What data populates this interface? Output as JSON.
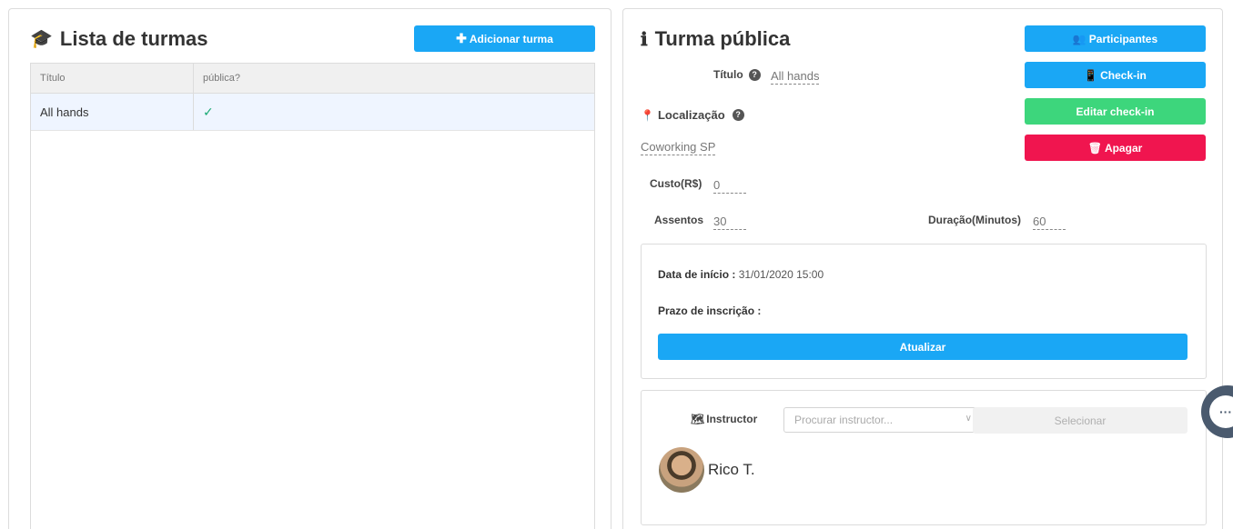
{
  "left": {
    "title": "Lista de turmas",
    "title_icon": "graduation-cap-icon",
    "add_button_label": "Adicionar turma",
    "table": {
      "columns": [
        "Título",
        "pública?"
      ],
      "rows": [
        {
          "title": "All hands",
          "public": "✓"
        }
      ]
    }
  },
  "right": {
    "title": "Turma pública",
    "title_icon": "info-icon",
    "buttons": {
      "participants": "Participantes",
      "checkin": "Check-in",
      "edit_checkin": "Editar check-in",
      "delete": "Apagar"
    },
    "fields": {
      "title_label": "Título",
      "title_value": "All hands",
      "location_label": "Localização",
      "location_value": "Coworking SP",
      "cost_label": "Custo(R$)",
      "cost_value": "0",
      "seats_label": "Assentos",
      "seats_value": "30",
      "duration_label": "Duração(Minutos)",
      "duration_value": "60"
    },
    "dates": {
      "start_label": "Data de início :",
      "start_value": "31/01/2020 15:00",
      "deadline_label": "Prazo de inscrição :",
      "update_button": "Atualizar"
    },
    "instructor": {
      "label": "Instructor",
      "search_placeholder": "Procurar instructor...",
      "select_button": "Selecionar",
      "selected_name": "Rico T."
    }
  },
  "chat_widget_icon": "ellipsis-icon",
  "colors": {
    "blue": "#1aa7f5",
    "green": "#3dd67c",
    "red": "#f0154f",
    "chat": "#4a5a6e"
  }
}
